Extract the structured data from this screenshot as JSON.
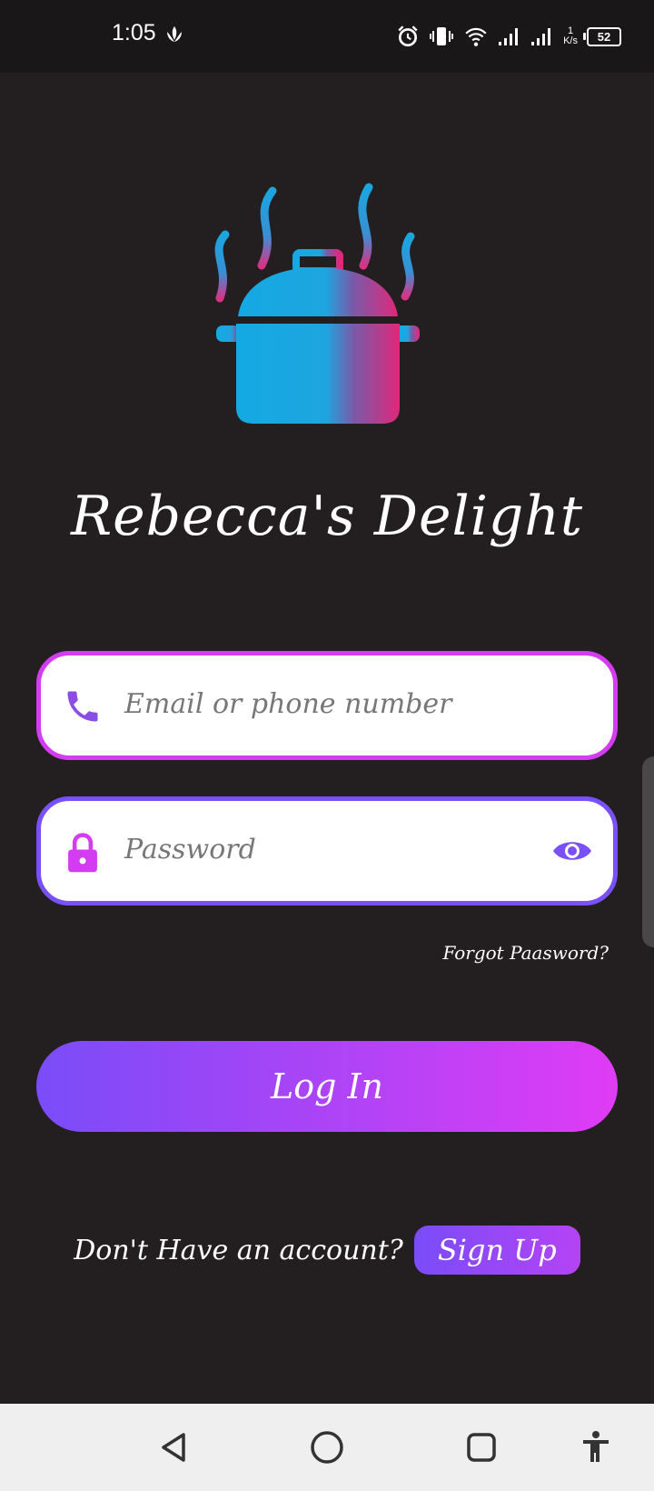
{
  "status_bar": {
    "time": "1:05",
    "net_speed_value": "1",
    "net_speed_unit": "K/s",
    "battery": "52",
    "icons": [
      "leaf-icon",
      "alarm-icon",
      "vibrate-icon",
      "wifi-icon",
      "signal-icon",
      "signal-icon"
    ]
  },
  "app": {
    "title": "Rebecca's Delight",
    "logo_icon": "steaming-pot-icon"
  },
  "form": {
    "email_placeholder": "Email or phone number",
    "password_placeholder": "Password",
    "forgot_link": "Forgot Paasword?",
    "login_label": "Log In"
  },
  "signup": {
    "prompt": "Don't Have an account?",
    "button_label": "Sign Up"
  },
  "colors": {
    "background": "#231f20",
    "accent_pink": "#d33cf0",
    "accent_purple": "#7a50fb",
    "logo_blue": "#1aa6e0"
  },
  "nav_bar": {
    "icons": [
      "back-icon",
      "home-icon",
      "recents-icon",
      "accessibility-icon"
    ]
  }
}
